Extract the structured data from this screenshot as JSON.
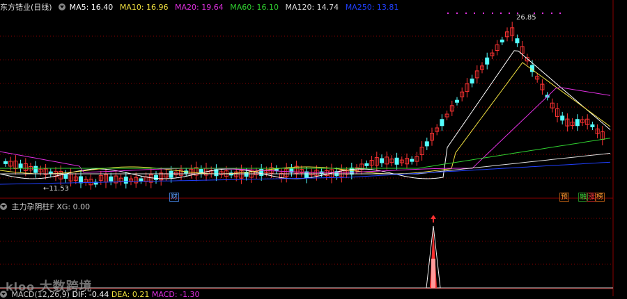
{
  "header": {
    "stock_name": "东方锆业(日线)",
    "ma": [
      {
        "label": "MA5: 16.40",
        "color": "#ffffff"
      },
      {
        "label": "MA10: 16.96",
        "color": "#f0e040"
      },
      {
        "label": "MA20: 19.64",
        "color": "#e030e0"
      },
      {
        "label": "MA60: 16.10",
        "color": "#30d030"
      },
      {
        "label": "MA120: 14.74",
        "color": "#dddddd"
      },
      {
        "label": "MA250: 13.81",
        "color": "#2040ff"
      }
    ]
  },
  "annotations": {
    "high_price": "26.85",
    "low_price": "←11.53",
    "cai_badge": "财",
    "yu_badge": "预",
    "rongzi_badge": "融",
    "zhang_badge": "涨",
    "bang_badge": "榜"
  },
  "sub_indicator": {
    "label": "主力孕阴柱F XG: 0.00"
  },
  "macd_legend": {
    "name": "MACD(12,26,9)",
    "dif": "DIF: -0.44",
    "dea": "DEA: 0.21",
    "macd": "MACD: -1.30"
  },
  "watermark": "大数跨境",
  "colors": {
    "up": "#ff3333",
    "down": "#54ffff",
    "grid": "#8a0000",
    "ma5": "#ffffff",
    "ma10": "#f0e040",
    "ma20": "#e030e0",
    "ma60": "#30d030",
    "ma120": "#dddddd",
    "ma250": "#2040ff"
  }
}
